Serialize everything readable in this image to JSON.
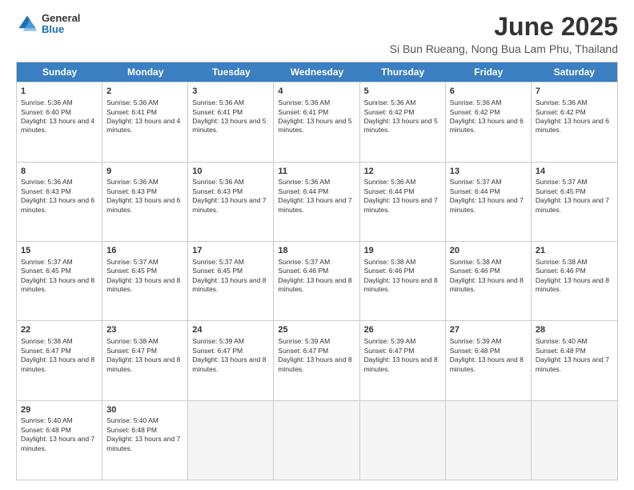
{
  "logo": {
    "general": "General",
    "blue": "Blue"
  },
  "title": "June 2025",
  "subtitle": "Si Bun Rueang, Nong Bua Lam Phu, Thailand",
  "calendar": {
    "headers": [
      "Sunday",
      "Monday",
      "Tuesday",
      "Wednesday",
      "Thursday",
      "Friday",
      "Saturday"
    ],
    "rows": [
      [
        {
          "day": "1",
          "rise": "Sunrise: 5:36 AM",
          "set": "Sunset: 6:40 PM",
          "daylight": "Daylight: 13 hours and 4 minutes."
        },
        {
          "day": "2",
          "rise": "Sunrise: 5:36 AM",
          "set": "Sunset: 6:41 PM",
          "daylight": "Daylight: 13 hours and 4 minutes."
        },
        {
          "day": "3",
          "rise": "Sunrise: 5:36 AM",
          "set": "Sunset: 6:41 PM",
          "daylight": "Daylight: 13 hours and 5 minutes."
        },
        {
          "day": "4",
          "rise": "Sunrise: 5:36 AM",
          "set": "Sunset: 6:41 PM",
          "daylight": "Daylight: 13 hours and 5 minutes."
        },
        {
          "day": "5",
          "rise": "Sunrise: 5:36 AM",
          "set": "Sunset: 6:42 PM",
          "daylight": "Daylight: 13 hours and 5 minutes."
        },
        {
          "day": "6",
          "rise": "Sunrise: 5:36 AM",
          "set": "Sunset: 6:42 PM",
          "daylight": "Daylight: 13 hours and 6 minutes."
        },
        {
          "day": "7",
          "rise": "Sunrise: 5:36 AM",
          "set": "Sunset: 6:42 PM",
          "daylight": "Daylight: 13 hours and 6 minutes."
        }
      ],
      [
        {
          "day": "8",
          "rise": "Sunrise: 5:36 AM",
          "set": "Sunset: 6:43 PM",
          "daylight": "Daylight: 13 hours and 6 minutes."
        },
        {
          "day": "9",
          "rise": "Sunrise: 5:36 AM",
          "set": "Sunset: 6:43 PM",
          "daylight": "Daylight: 13 hours and 6 minutes."
        },
        {
          "day": "10",
          "rise": "Sunrise: 5:36 AM",
          "set": "Sunset: 6:43 PM",
          "daylight": "Daylight: 13 hours and 7 minutes."
        },
        {
          "day": "11",
          "rise": "Sunrise: 5:36 AM",
          "set": "Sunset: 6:44 PM",
          "daylight": "Daylight: 13 hours and 7 minutes."
        },
        {
          "day": "12",
          "rise": "Sunrise: 5:36 AM",
          "set": "Sunset: 6:44 PM",
          "daylight": "Daylight: 13 hours and 7 minutes."
        },
        {
          "day": "13",
          "rise": "Sunrise: 5:37 AM",
          "set": "Sunset: 6:44 PM",
          "daylight": "Daylight: 13 hours and 7 minutes."
        },
        {
          "day": "14",
          "rise": "Sunrise: 5:37 AM",
          "set": "Sunset: 6:45 PM",
          "daylight": "Daylight: 13 hours and 7 minutes."
        }
      ],
      [
        {
          "day": "15",
          "rise": "Sunrise: 5:37 AM",
          "set": "Sunset: 6:45 PM",
          "daylight": "Daylight: 13 hours and 8 minutes."
        },
        {
          "day": "16",
          "rise": "Sunrise: 5:37 AM",
          "set": "Sunset: 6:45 PM",
          "daylight": "Daylight: 13 hours and 8 minutes."
        },
        {
          "day": "17",
          "rise": "Sunrise: 5:37 AM",
          "set": "Sunset: 6:45 PM",
          "daylight": "Daylight: 13 hours and 8 minutes."
        },
        {
          "day": "18",
          "rise": "Sunrise: 5:37 AM",
          "set": "Sunset: 6:46 PM",
          "daylight": "Daylight: 13 hours and 8 minutes."
        },
        {
          "day": "19",
          "rise": "Sunrise: 5:38 AM",
          "set": "Sunset: 6:46 PM",
          "daylight": "Daylight: 13 hours and 8 minutes."
        },
        {
          "day": "20",
          "rise": "Sunrise: 5:38 AM",
          "set": "Sunset: 6:46 PM",
          "daylight": "Daylight: 13 hours and 8 minutes."
        },
        {
          "day": "21",
          "rise": "Sunrise: 5:38 AM",
          "set": "Sunset: 6:46 PM",
          "daylight": "Daylight: 13 hours and 8 minutes."
        }
      ],
      [
        {
          "day": "22",
          "rise": "Sunrise: 5:38 AM",
          "set": "Sunset: 6:47 PM",
          "daylight": "Daylight: 13 hours and 8 minutes."
        },
        {
          "day": "23",
          "rise": "Sunrise: 5:38 AM",
          "set": "Sunset: 6:47 PM",
          "daylight": "Daylight: 13 hours and 8 minutes."
        },
        {
          "day": "24",
          "rise": "Sunrise: 5:39 AM",
          "set": "Sunset: 6:47 PM",
          "daylight": "Daylight: 13 hours and 8 minutes."
        },
        {
          "day": "25",
          "rise": "Sunrise: 5:39 AM",
          "set": "Sunset: 6:47 PM",
          "daylight": "Daylight: 13 hours and 8 minutes."
        },
        {
          "day": "26",
          "rise": "Sunrise: 5:39 AM",
          "set": "Sunset: 6:47 PM",
          "daylight": "Daylight: 13 hours and 8 minutes."
        },
        {
          "day": "27",
          "rise": "Sunrise: 5:39 AM",
          "set": "Sunset: 6:48 PM",
          "daylight": "Daylight: 13 hours and 8 minutes."
        },
        {
          "day": "28",
          "rise": "Sunrise: 5:40 AM",
          "set": "Sunset: 6:48 PM",
          "daylight": "Daylight: 13 hours and 7 minutes."
        }
      ],
      [
        {
          "day": "29",
          "rise": "Sunrise: 5:40 AM",
          "set": "Sunset: 6:48 PM",
          "daylight": "Daylight: 13 hours and 7 minutes."
        },
        {
          "day": "30",
          "rise": "Sunrise: 5:40 AM",
          "set": "Sunset: 6:48 PM",
          "daylight": "Daylight: 13 hours and 7 minutes."
        },
        null,
        null,
        null,
        null,
        null
      ]
    ]
  }
}
